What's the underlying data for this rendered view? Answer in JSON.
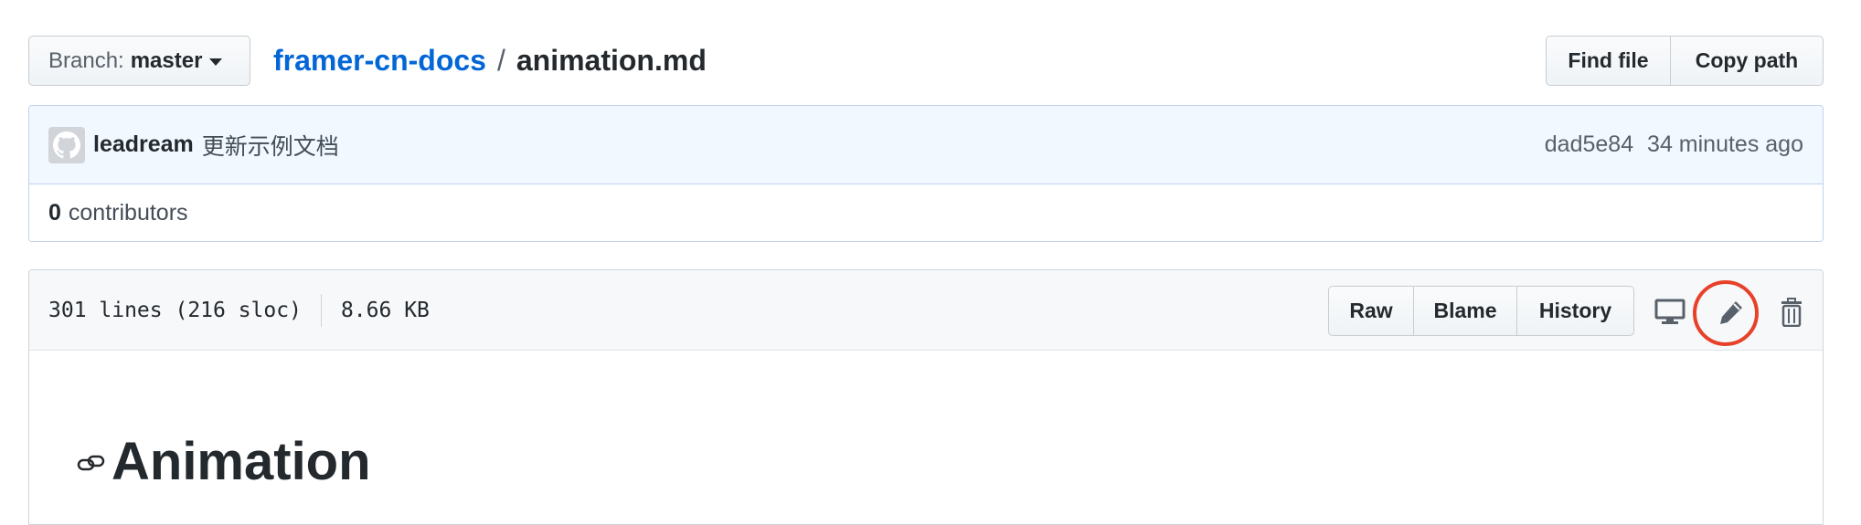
{
  "branch": {
    "label": "Branch:",
    "value": "master"
  },
  "breadcrumb": {
    "repo": "framer-cn-docs",
    "separator": "/",
    "file": "animation.md"
  },
  "file_nav": {
    "find_file": "Find file",
    "copy_path": "Copy path"
  },
  "commit": {
    "author": "leadream",
    "message": "更新示例文档",
    "sha": "dad5e84",
    "time": "34 minutes ago"
  },
  "contributors": {
    "count": "0",
    "label": "contributors"
  },
  "file_header": {
    "lines": "301 lines (216 sloc)",
    "size": "8.66 KB",
    "raw": "Raw",
    "blame": "Blame",
    "history": "History"
  },
  "icons": {
    "desktop": "desktop-icon",
    "edit": "pencil-icon",
    "delete": "trash-icon",
    "anchor": "link-icon",
    "avatar": "github-octocat-avatar"
  },
  "highlight": {
    "color": "#e8412a",
    "target": "pencil-icon"
  },
  "markdown": {
    "heading": "Animation"
  },
  "colors": {
    "link": "#0366d6",
    "commit_bg": "#f1f8ff",
    "header_bg": "#f6f8fa"
  }
}
